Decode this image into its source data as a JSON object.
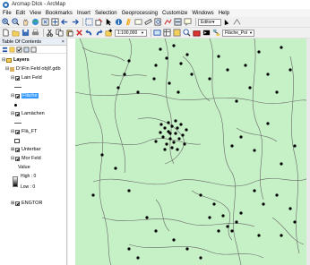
{
  "window": {
    "title": "Arcmap DIck - ArcMap"
  },
  "menu": [
    "File",
    "Edit",
    "View",
    "Bookmarks",
    "Insert",
    "Selection",
    "Geoprocessing",
    "Customize",
    "Windows",
    "Help"
  ],
  "toolbar": {
    "scale_value": "1:100,000",
    "editor_label": "Editor▾",
    "layer_combo": "Fläche_Pol",
    "icons1": [
      "zoom-in-icon",
      "zoom-out-icon",
      "pan-icon",
      "full-extent-icon",
      "fixed-zoom-in-icon",
      "fixed-zoom-out-icon",
      "back-icon",
      "forward-icon",
      "select-icon",
      "clear-selection-icon",
      "select-elements-icon",
      "identify-icon",
      "hyperlink-icon",
      "html-popup-icon",
      "measure-icon",
      "find-icon",
      "route-icon",
      "time-slider-icon",
      "map-tips-icon"
    ],
    "icons2": [
      "new-icon",
      "open-icon",
      "save-icon",
      "print-icon",
      "cut-icon",
      "copy-icon",
      "paste-icon",
      "delete-icon",
      "undo-icon",
      "redo-icon",
      "add-data-icon"
    ]
  },
  "toc": {
    "title": "Table Of Contents",
    "close": "×",
    "layers_label": "Layers",
    "gdb_label": "D:\\Fin Feld obj\\f.gdb",
    "items": [
      {
        "label": "Lain Feld",
        "symbol": "line"
      },
      {
        "label": "Fläche",
        "symbol": "dot",
        "selected": true
      },
      {
        "label": "Lamächen",
        "symbol": "line"
      },
      {
        "label": "Flä_FT",
        "symbol": "box"
      },
      {
        "label": "Unterbar",
        "symbol": "line"
      },
      {
        "label": "Mor Feld",
        "symbol": "grad"
      }
    ],
    "value_label": "Value",
    "high_label": "High : 0",
    "low_label": "Low : 0",
    "last_label": "ENGTOR"
  },
  "map": {
    "background": "#c6f0c6",
    "line_color": "#666666",
    "point_color": "#000000"
  }
}
